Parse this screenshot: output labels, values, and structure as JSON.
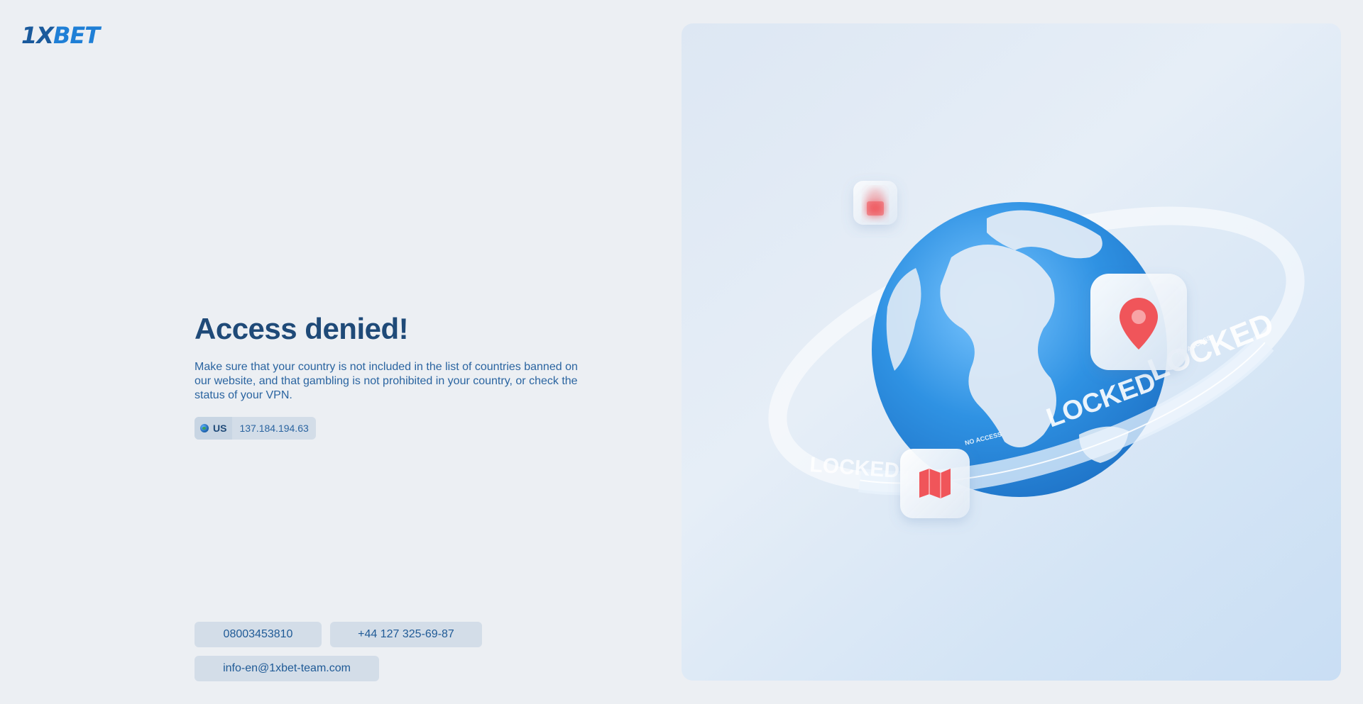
{
  "brand": {
    "logo_part1": "1X",
    "logo_part2": "BET"
  },
  "main": {
    "title": "Access denied!",
    "description": "Make sure that your country is not included in the list of countries banned on our website, and that gambling is not prohibited in your country, or check the status of your VPN.",
    "country_code": "US",
    "ip_address": "137.184.194.63"
  },
  "contacts": {
    "phone_1": "08003453810",
    "phone_2": "+44 127 325-69-87",
    "email": "info-en@1xbet-team.com"
  },
  "illustration": {
    "ring_label": "LOCKED",
    "ring_small_label": "NO ACCESS",
    "icons": [
      "lock-icon",
      "map-pin-icon",
      "map-icon"
    ]
  },
  "colors": {
    "background": "#eceff3",
    "title": "#1f4a78",
    "text": "#2a64a0",
    "button_bg": "#d3dde8",
    "accent_red": "#f0545a",
    "globe_blue": "#2a8de0"
  }
}
